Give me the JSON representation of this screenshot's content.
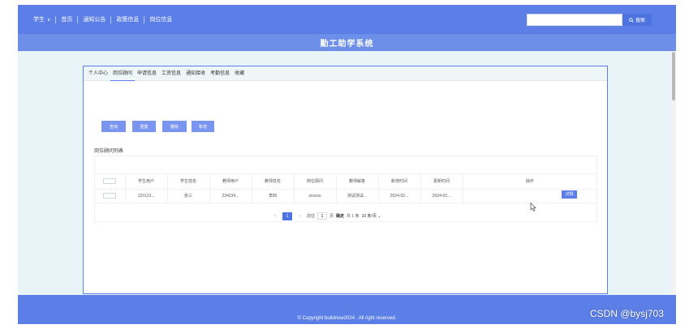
{
  "nav": {
    "user_menu": "学生",
    "items": [
      "首页",
      "通知公告",
      "政策信息",
      "岗位信息"
    ],
    "search_placeholder": "",
    "search_button": "搜索"
  },
  "header": {
    "title": "勤工助学系统"
  },
  "tabs": [
    {
      "label": "个人中心",
      "active": false
    },
    {
      "label": "岗位顾问",
      "active": true
    },
    {
      "label": "申请信息",
      "active": false
    },
    {
      "label": "工资信息",
      "active": false
    },
    {
      "label": "通知接收",
      "active": false
    },
    {
      "label": "考勤信息",
      "active": false
    },
    {
      "label": "收藏",
      "active": false
    }
  ],
  "toolbar": {
    "query": "查询",
    "reset": "重置",
    "delete": "删除",
    "add": "新增"
  },
  "list": {
    "title": "岗位顾问列表",
    "columns": [
      "学生用户",
      "学生姓名",
      "教师用户",
      "教师姓名",
      "岗位顾问",
      "教师解答",
      "新增时间",
      "更新时间",
      "操作"
    ],
    "rows": [
      {
        "student_user": "123123...",
        "student_name": "张三",
        "teacher_user": "234234...",
        "teacher_name": "李四",
        "question": "xxxxxx",
        "answer": "测试测试...",
        "created": "2024-02...",
        "updated": "2024-02...",
        "action": "详情"
      }
    ]
  },
  "pagination": {
    "current_page": "1",
    "goto_label": "前往",
    "goto_value": "1",
    "page_unit": "页",
    "confirm": "确定",
    "total": "共 1 条",
    "page_size": "10 条/页"
  },
  "footer": {
    "text": "© Copyright buildnow2024 . All right reserved."
  },
  "watermark": "CSDN @bysj703",
  "colors": {
    "primary": "#5b7fe6",
    "title_bar": "#6e8fe9",
    "background": "#e8f4f8",
    "button": "#7a95ed"
  }
}
